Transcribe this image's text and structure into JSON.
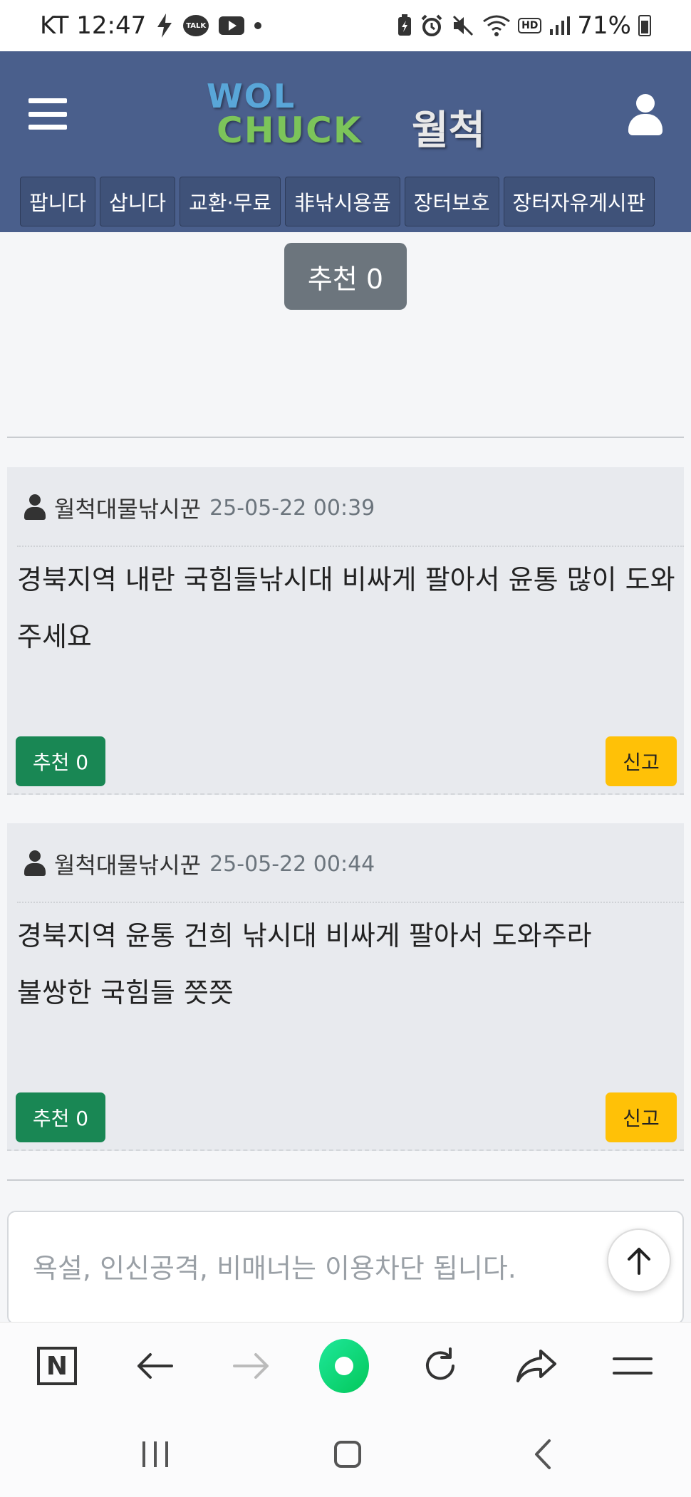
{
  "status_bar": {
    "carrier_time": "KT 12:47",
    "talk_label": "TALK",
    "hd_label": "HD",
    "battery": "71%"
  },
  "header": {
    "logo_line1": "WOL",
    "logo_line2": "CHUCK",
    "logo_korean": "월척",
    "categories": [
      "팝니다",
      "삽니다",
      "교환·무료",
      "非낚시용품",
      "장터보호",
      "장터자유게시판"
    ]
  },
  "post": {
    "recommend_label": "추천 0"
  },
  "comments": [
    {
      "author": "월척대물낚시꾼",
      "date": "25-05-22 00:39",
      "text": "경북지역 내란 국힘들낚시대 비싸게 팔아서 윤통 많이 도와 주세요",
      "recommend_label": "추천 0",
      "report_label": "신고"
    },
    {
      "author": "월척대물낚시꾼",
      "date": "25-05-22 00:44",
      "text_line1": "경북지역 윤통 건희 낚시대 비싸게 팔아서 도와주라",
      "text_line2": "불쌍한 국힘들 쯧쯧",
      "recommend_label": "추천 0",
      "report_label": "신고"
    }
  ],
  "comment_form": {
    "placeholder": "욕설, 인신공격, 비매너는 이용차단 됩니다."
  },
  "browser_toolbar": {
    "naver_label": "N",
    "icons": [
      "naver-icon",
      "back-arrow-icon",
      "forward-arrow-icon",
      "green-dot-icon",
      "refresh-icon",
      "share-icon",
      "menu-icon"
    ]
  },
  "colors": {
    "header_bg": "#4a5f8c",
    "recommend_green": "#198754",
    "report_yellow": "#ffc107",
    "recommend_gray": "#6c757d"
  }
}
